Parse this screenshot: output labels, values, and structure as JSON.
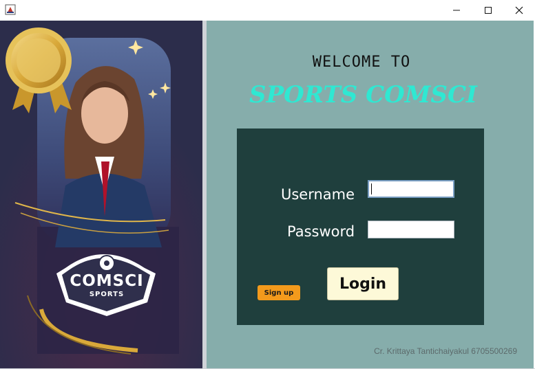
{
  "window": {
    "icons": {
      "app": "java-app-icon",
      "minimize": "minimize-icon",
      "maximize": "maximize-icon",
      "close": "close-icon"
    }
  },
  "banner": {
    "logo_text": "COMSCI",
    "logo_subtext": "SPORTS",
    "colors": {
      "background": "#2c2d4b",
      "gold": "#d9a93a"
    }
  },
  "main": {
    "welcome_text": "WELCOME TO",
    "brand_text": "SPORTS COMSCI",
    "form": {
      "username_label": "Username",
      "username_value": "",
      "password_label": "Password",
      "password_value": ""
    },
    "signup_label": "Sign up",
    "login_label": "Login",
    "credit_text": "Cr. Krittaya Tantichaiyakul 6705500269"
  },
  "colors": {
    "right_bg": "#86adab",
    "box_bg": "#1f3f3d",
    "brand": "#2fe8d2",
    "signup": "#f39a1c",
    "login": "#fdf9d8"
  }
}
